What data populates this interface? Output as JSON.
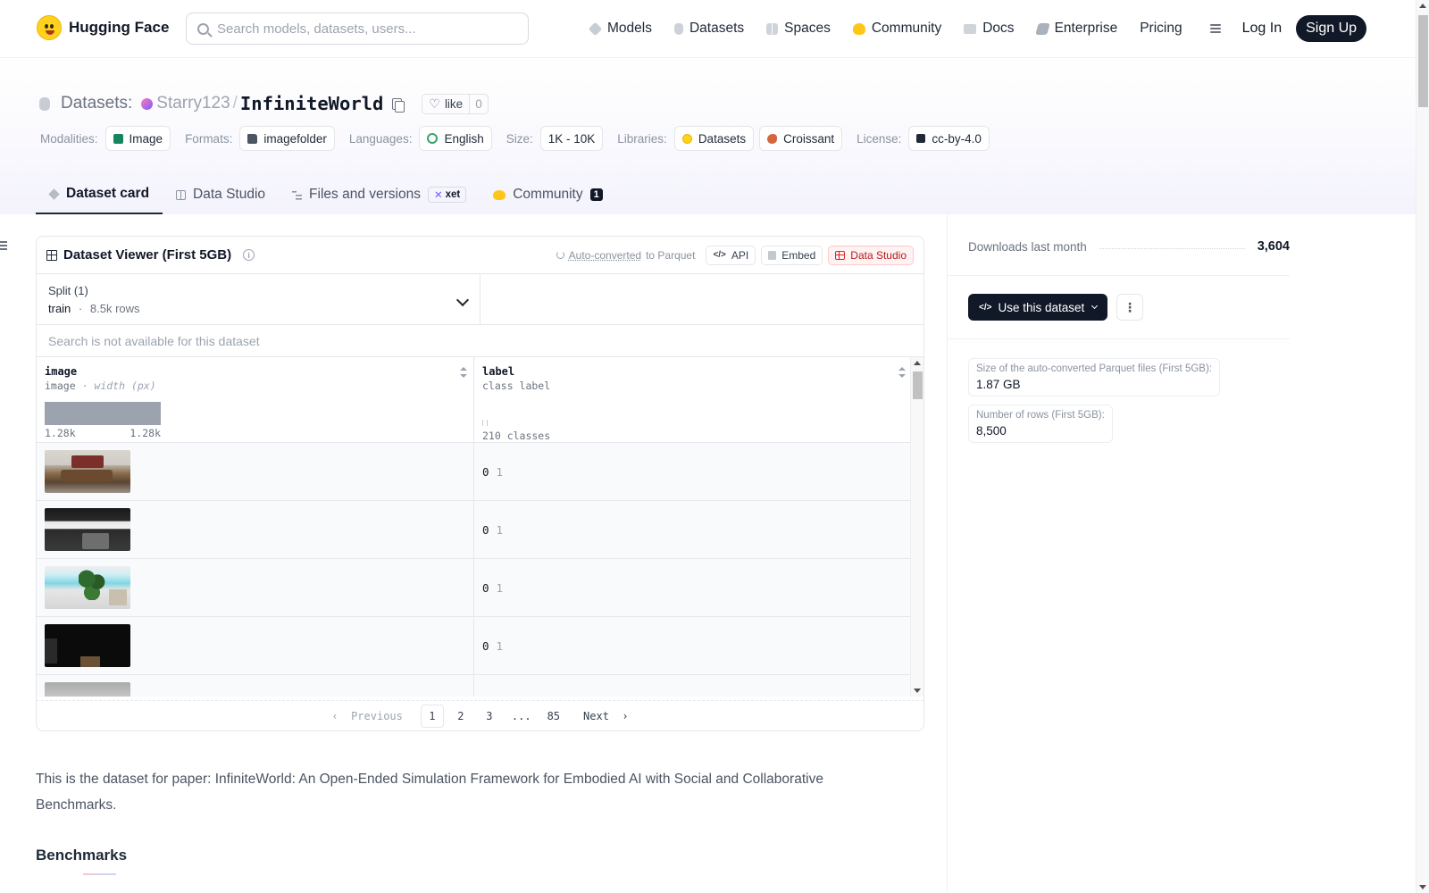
{
  "nav": {
    "brand": "Hugging Face",
    "search_placeholder": "Search models, datasets, users...",
    "links": [
      {
        "label": "Models",
        "icon": "models-icon"
      },
      {
        "label": "Datasets",
        "icon": "datasets-icon"
      },
      {
        "label": "Spaces",
        "icon": "spaces-icon"
      },
      {
        "label": "Community",
        "icon": "community-icon"
      },
      {
        "label": "Docs",
        "icon": "docs-icon"
      },
      {
        "label": "Enterprise",
        "icon": "enterprise-icon"
      },
      {
        "label": "Pricing",
        "icon": ""
      }
    ],
    "login": "Log In",
    "signup": "Sign Up"
  },
  "header": {
    "section": "Datasets:",
    "owner": "Starry123",
    "separator": "/",
    "name": "InfiniteWorld",
    "like_label": "like",
    "like_count": "0",
    "meta": {
      "modalities_label": "Modalities:",
      "modalities": "Image",
      "formats_label": "Formats:",
      "formats": "imagefolder",
      "languages_label": "Languages:",
      "languages": "English",
      "size_label": "Size:",
      "size": "1K - 10K",
      "libraries_label": "Libraries:",
      "libraries": [
        "Datasets",
        "Croissant"
      ],
      "license_label": "License:",
      "license": "cc-by-4.0"
    },
    "tabs": [
      {
        "label": "Dataset card",
        "active": true
      },
      {
        "label": "Data Studio",
        "active": false
      },
      {
        "label": "Files and versions",
        "active": false,
        "tag": "xet"
      },
      {
        "label": "Community",
        "active": false,
        "badge": "1"
      }
    ]
  },
  "viewer": {
    "title": "Dataset Viewer (First 5GB)",
    "auto_converted": "Auto-converted",
    "to_parquet": "to Parquet",
    "api_label": "API",
    "embed_label": "Embed",
    "studio_label": "Data Studio",
    "split_label": "Split (1)",
    "split_name": "train",
    "split_sep": "·",
    "split_rows": "8.5k rows",
    "search_disabled": "Search is not available for this dataset",
    "columns": [
      {
        "name": "image",
        "type": "image",
        "type_note": "· width (px)",
        "hist_min": "1.28k",
        "hist_max": "1.28k"
      },
      {
        "name": "label",
        "type": "class label",
        "classes": "210 classes"
      }
    ],
    "rows": [
      {
        "label": "0",
        "label_name": "1"
      },
      {
        "label": "0",
        "label_name": "1"
      },
      {
        "label": "0",
        "label_name": "1"
      },
      {
        "label": "0",
        "label_name": "1"
      }
    ],
    "pager": {
      "prev": "Previous",
      "pages": [
        "1",
        "2",
        "3",
        "...",
        "85"
      ],
      "current": "1",
      "next": "Next"
    }
  },
  "card": {
    "description": "This is the dataset for paper: InfiniteWorld: An Open-Ended Simulation Framework for Embodied AI with Social and Collaborative Benchmarks.",
    "heading": "Benchmarks"
  },
  "sidebar": {
    "downloads_label": "Downloads last month",
    "downloads_value": "3,604",
    "use_button": "Use this dataset",
    "parquet_size_label": "Size of the auto-converted Parquet files (First 5GB):",
    "parquet_size_value": "1.87 GB",
    "num_rows_label": "Number of rows (First 5GB):",
    "num_rows_value": "8,500"
  },
  "colors": {
    "primary_dark": "#111827",
    "accent_red": "#dc2626",
    "header_tint": "#f4f3fd"
  }
}
